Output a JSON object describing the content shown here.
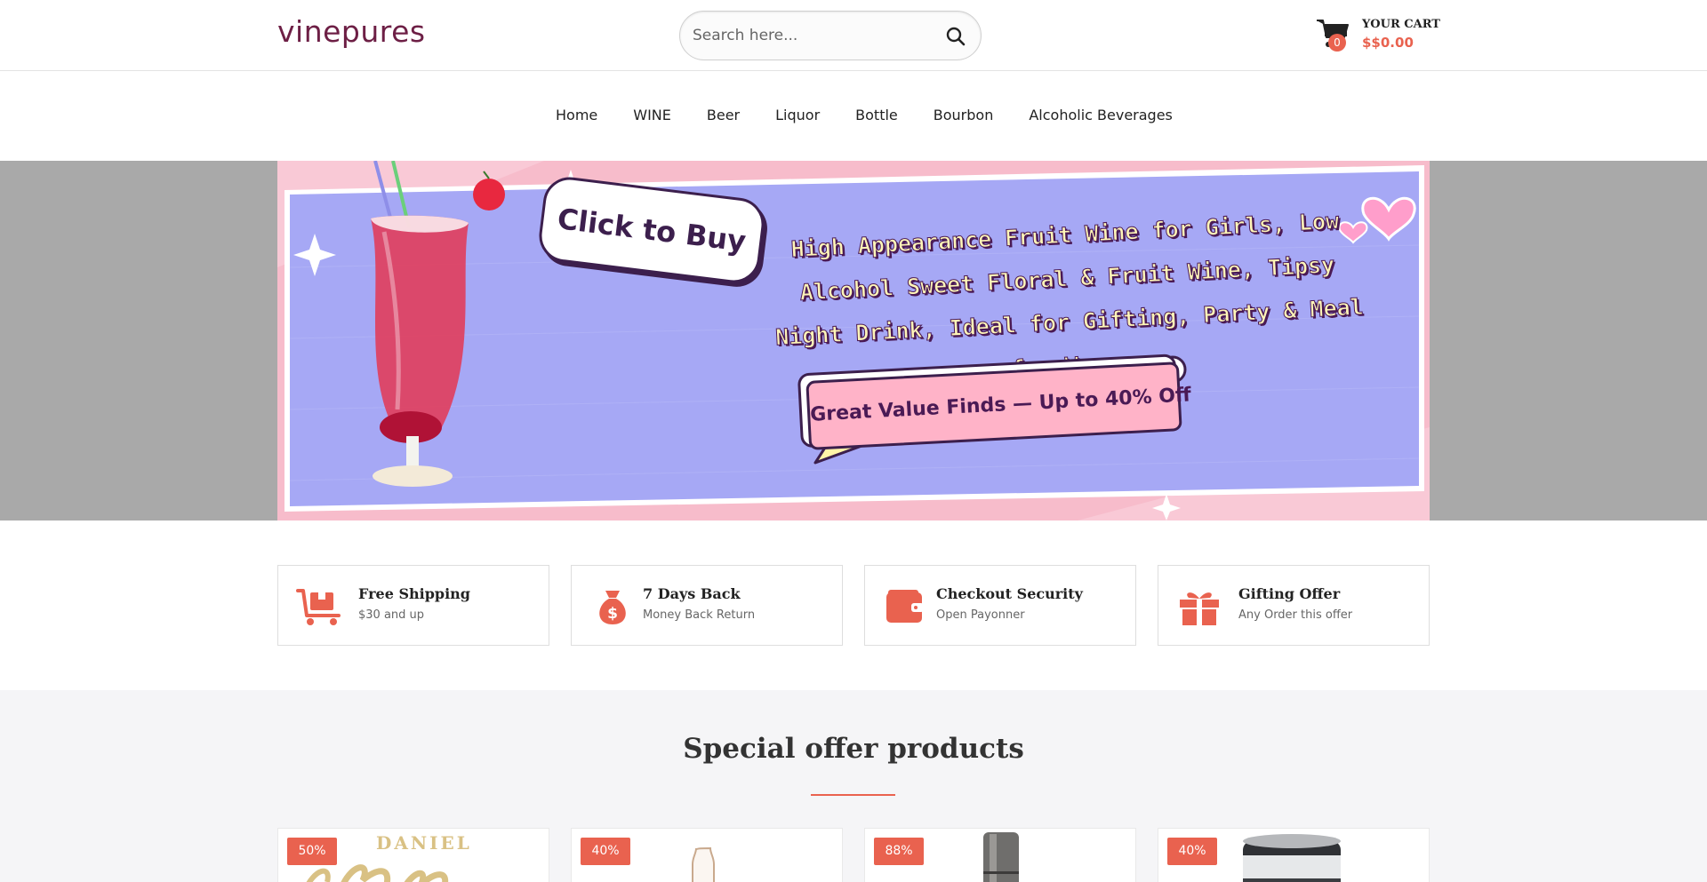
{
  "header": {
    "logo": "vinepures",
    "search_placeholder": "Search here...",
    "cart_label": "YOUR CART",
    "cart_total": "$$0.00",
    "cart_count": "0"
  },
  "nav": {
    "items": [
      "Home",
      "WINE",
      "Beer",
      "Liquor",
      "Bottle",
      "Bourbon",
      "Alcoholic Beverages"
    ]
  },
  "banner": {
    "click_to_buy": "Click to Buy",
    "headline": "High Appearance Fruit Wine for Girls, Low Alcohol Sweet Floral & Fruit Wine, Tipsy Night Drink, Ideal for Gifting, Party & Meal for Women",
    "deal": "Great Value Finds — Up to 40% Off"
  },
  "features": [
    {
      "title": "Free Shipping",
      "subtitle": "$30 and up",
      "icon": "cart-box-icon"
    },
    {
      "title": "7 Days Back",
      "subtitle": "Money Back Return",
      "icon": "money-bag-icon"
    },
    {
      "title": "Checkout Security",
      "subtitle": "Open Payonner",
      "icon": "wallet-icon"
    },
    {
      "title": "Gifting Offer",
      "subtitle": "Any Order this offer",
      "icon": "gift-icon"
    }
  ],
  "offers": {
    "title": "Special offer products",
    "products": [
      {
        "discount": "50%",
        "brand_text": "DANIEL"
      },
      {
        "discount": "40%"
      },
      {
        "discount": "88%"
      },
      {
        "discount": "40%"
      }
    ]
  },
  "colors": {
    "brand": "#6d1f45",
    "accent": "#e9624f",
    "banner_bg": "#a6a8f5",
    "banner_frame": "#f7bccb"
  }
}
